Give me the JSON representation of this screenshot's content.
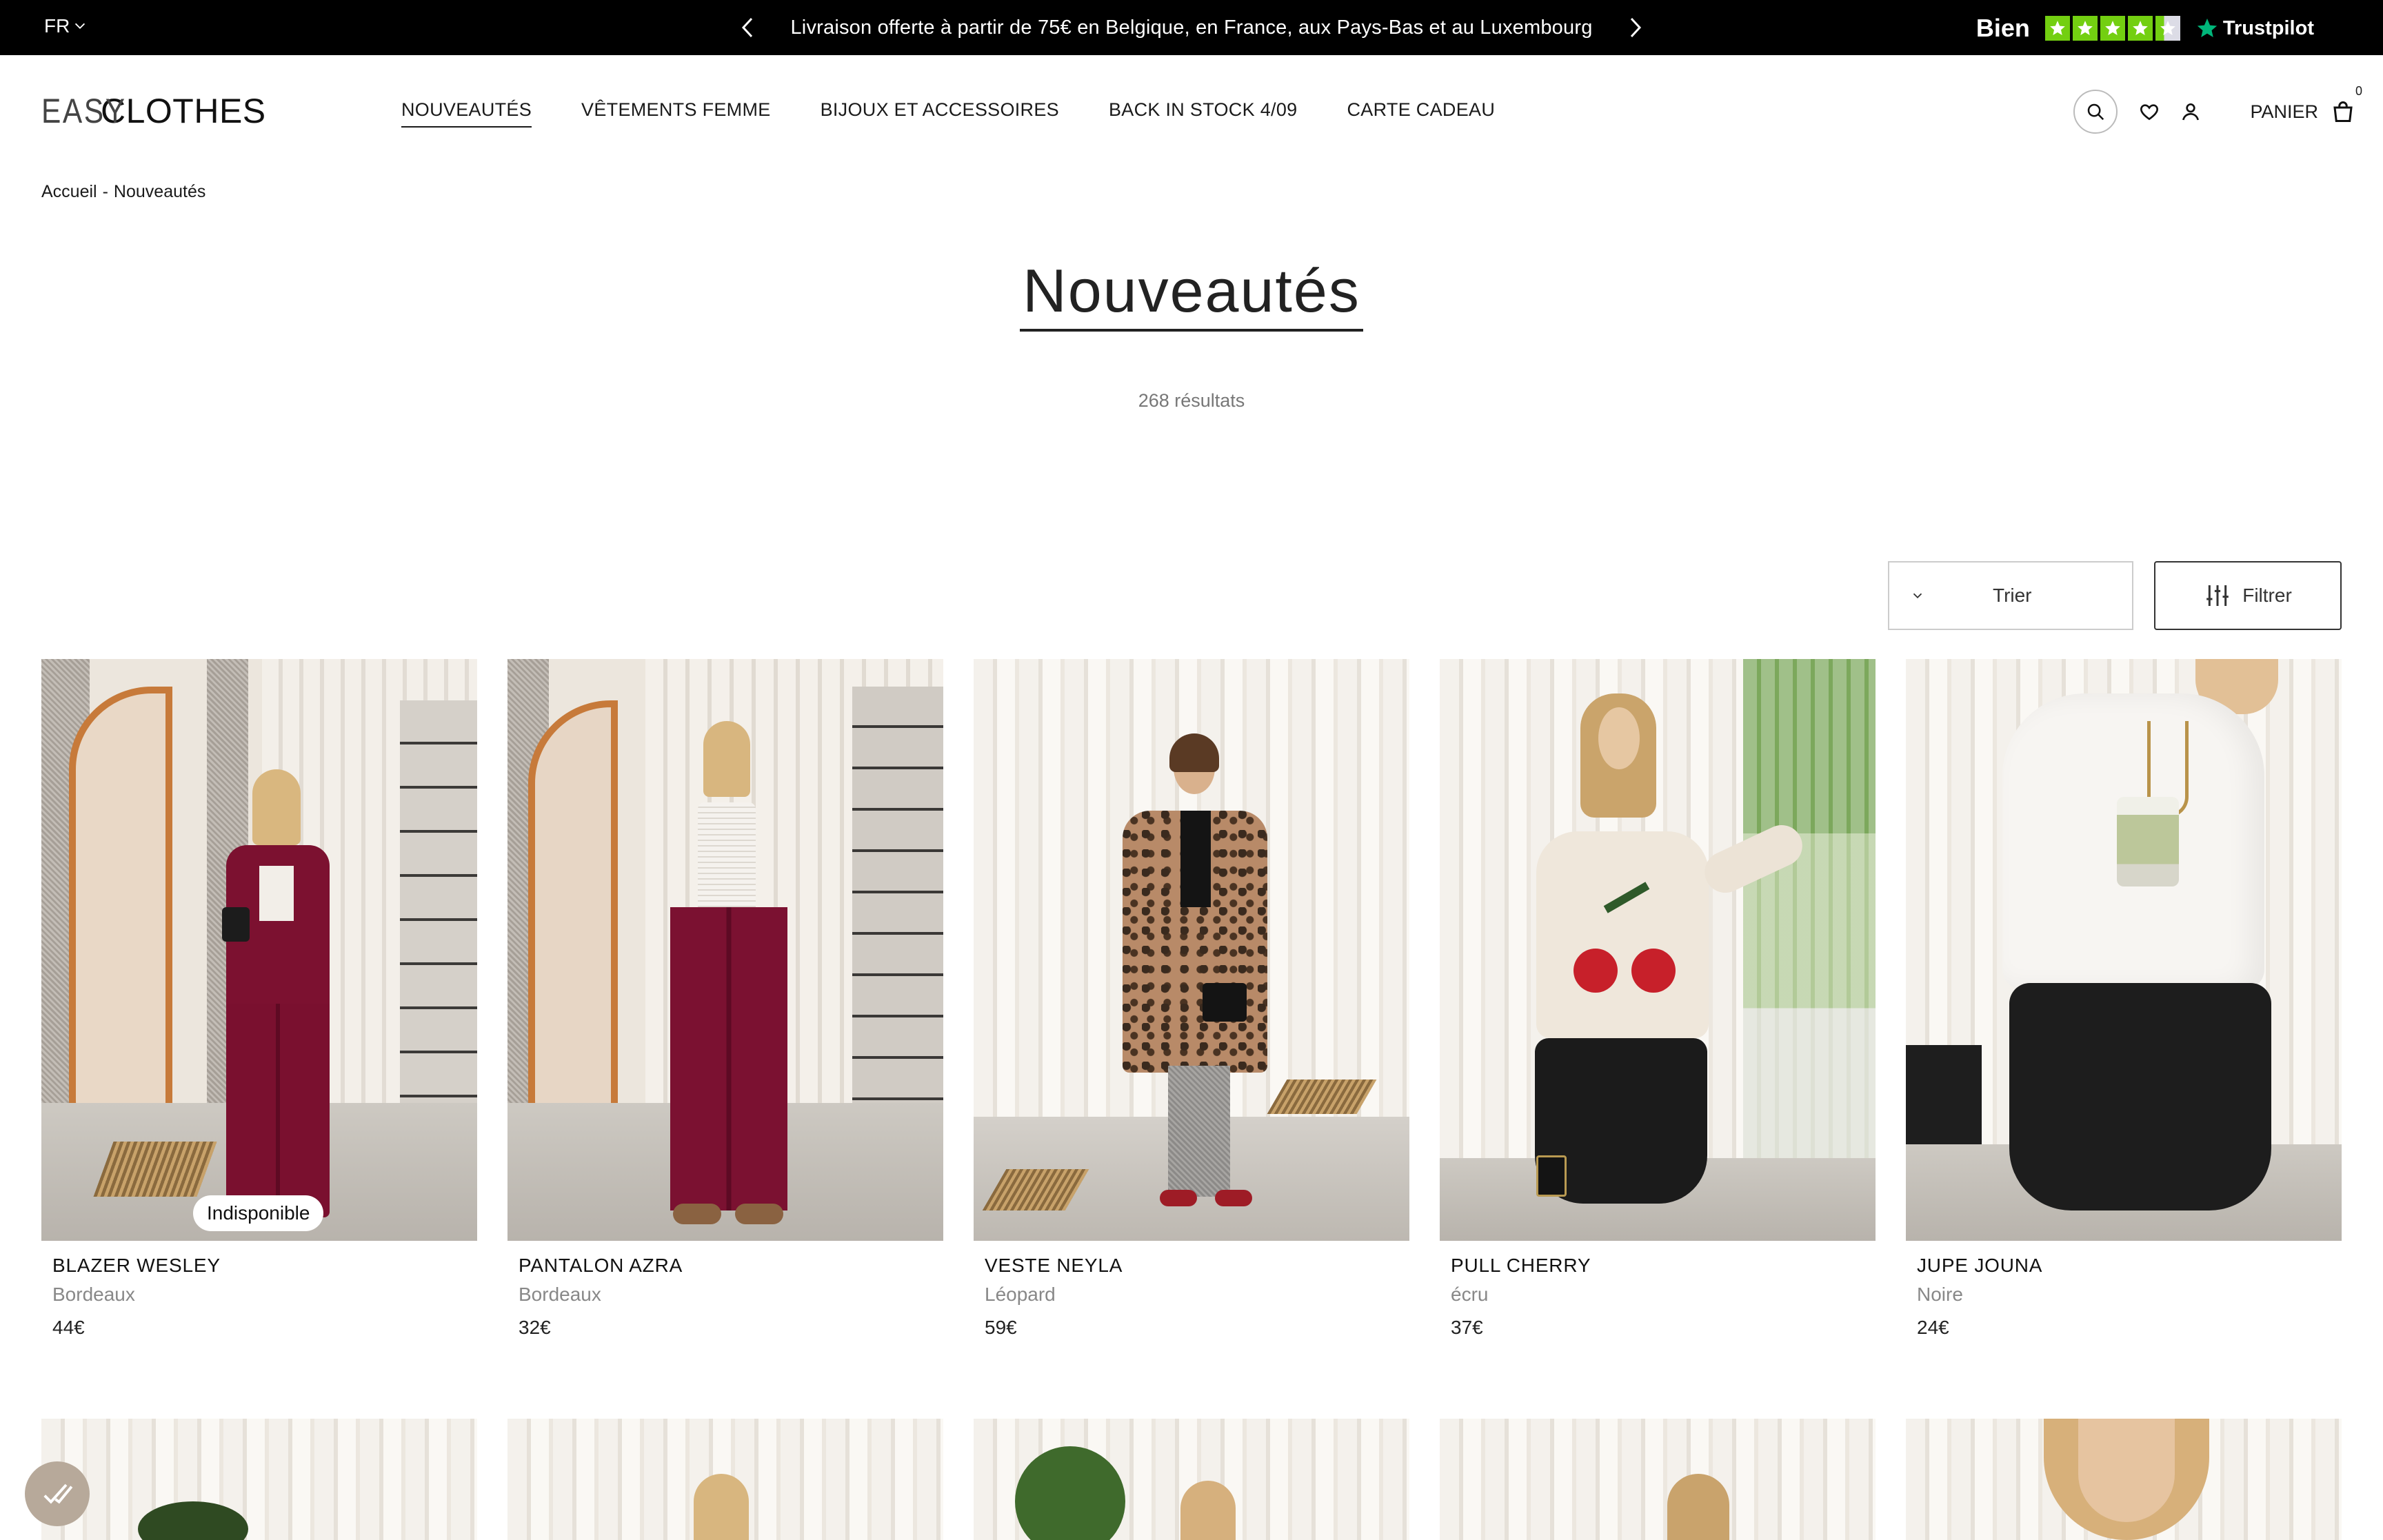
{
  "topbar": {
    "language": "FR",
    "announcement": "Livraison offerte à partir de 75€ en Belgique, en France, aux Pays-Bas et au Luxembourg",
    "rating_word": "Bien",
    "rating_stars": 4.5,
    "trustpilot": "Trustpilot",
    "colors": {
      "bar": "#000000",
      "star": "#73cf11",
      "star_empty": "#dcdce6"
    }
  },
  "header": {
    "logo_light": "EASY",
    "logo_bold": "CLOTHES",
    "nav": [
      {
        "label": "NOUVEAUTÉS",
        "active": true
      },
      {
        "label": "VÊTEMENTS FEMME",
        "active": false
      },
      {
        "label": "BIJOUX ET ACCESSOIRES",
        "active": false
      },
      {
        "label": "BACK IN STOCK 4/09",
        "active": false
      },
      {
        "label": "CARTE CADEAU",
        "active": false
      }
    ],
    "cart_label": "PANIER",
    "cart_count": "0",
    "icons": [
      "search-icon",
      "heart-icon",
      "user-icon",
      "bag-icon"
    ]
  },
  "breadcrumb": {
    "home": "Accueil",
    "separator": "-",
    "current": "Nouveautés"
  },
  "page": {
    "title": "Nouveautés",
    "results": "268 résultats"
  },
  "controls": {
    "sort_label": "Trier",
    "filter_label": "Filtrer"
  },
  "products": [
    {
      "name": "BLAZER WESLEY",
      "color": "Bordeaux",
      "price": "44€",
      "badge": "Indisponible"
    },
    {
      "name": "PANTALON AZRA",
      "color": "Bordeaux",
      "price": "32€",
      "badge": ""
    },
    {
      "name": "VESTE NEYLA",
      "color": "Léopard",
      "price": "59€",
      "badge": ""
    },
    {
      "name": "PULL CHERRY",
      "color": "écru",
      "price": "37€",
      "badge": ""
    },
    {
      "name": "JUPE JOUNA",
      "color": "Noire",
      "price": "24€",
      "badge": ""
    }
  ]
}
